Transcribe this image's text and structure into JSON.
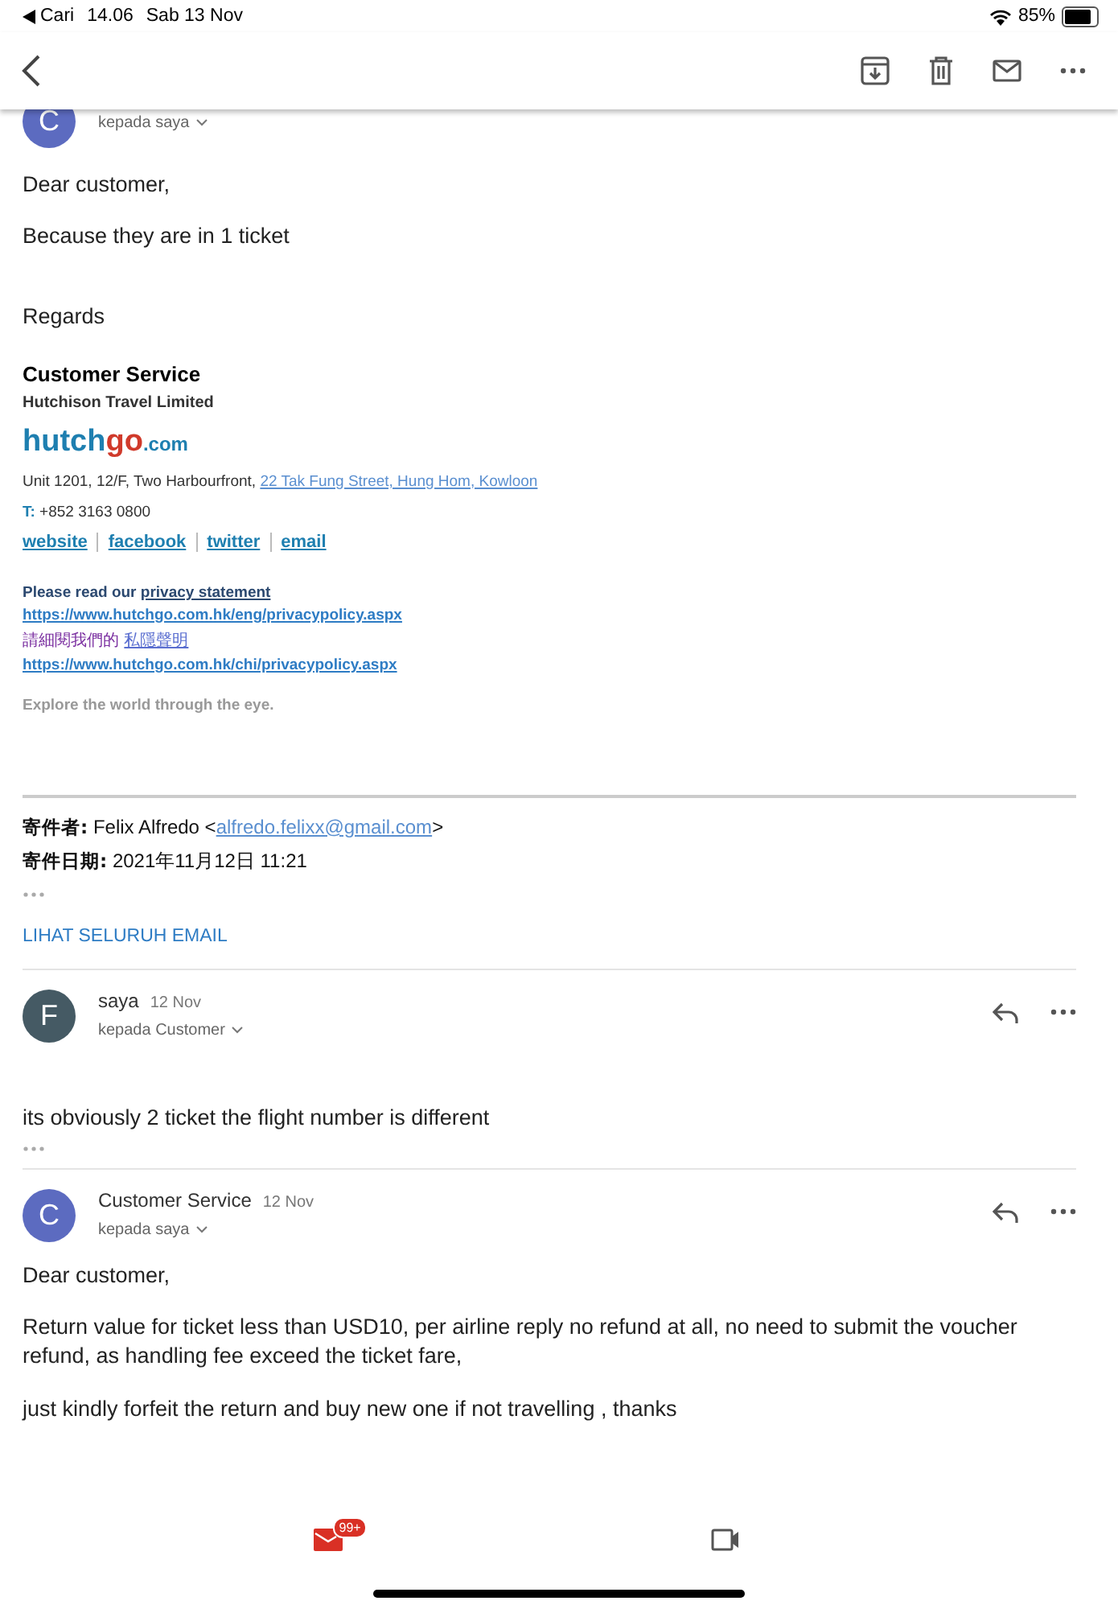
{
  "status_bar": {
    "back_app": "Cari",
    "time": "14.06",
    "date": "Sab 13 Nov",
    "battery": "85%"
  },
  "first_message": {
    "avatar": "C",
    "color": "#5c6bc0",
    "recipient": "kepada saya",
    "paragraphs": [
      "Dear customer,",
      "Because they are in 1 ticket",
      "Regards"
    ],
    "signature": {
      "name": "Customer Service",
      "company": "Hutchison Travel Limited",
      "logo_main": "hutch",
      "logo_accent": "go",
      "logo_suffix": ".com",
      "address": "Unit 1201, 12/F, Two Harbourfront, ",
      "address_link": "22 Tak Fung Street, Hung Hom, Kowloon",
      "phone_label": "T:",
      "phone": "+852 3163 0800",
      "links": [
        "website",
        "facebook",
        "twitter",
        "email"
      ],
      "privacy_text": "Please read our ",
      "privacy_link": "privacy statement",
      "privacy_url_en": "https://www.hutchgo.com.hk/eng/privacypolicy.aspx",
      "privacy_text_zh": "請細閱我們的 ",
      "privacy_link_zh": "私隱聲明",
      "privacy_url_zh": "https://www.hutchgo.com.hk/chi/privacypolicy.aspx",
      "tagline": "Explore the world through the eye."
    },
    "quoted": {
      "from_label": "寄件者:",
      "from_name": "Felix Alfredo <",
      "from_email": "alfredo.felixx@gmail.com",
      "from_end": ">",
      "date_label": "寄件日期:",
      "date": "2021年11月12日 11:21"
    },
    "show_all": "LIHAT SELURUH EMAIL"
  },
  "messages": [
    {
      "avatar": "F",
      "color": "#455a64",
      "sender": "saya",
      "date": "12 Nov",
      "recipient": "kepada Customer",
      "paragraphs": [
        "its obviously 2 ticket the flight number is different"
      ],
      "trimmed": true
    },
    {
      "avatar": "C",
      "color": "#5c6bc0",
      "sender": "Customer Service",
      "date": "12 Nov",
      "recipient": "kepada saya",
      "paragraphs": [
        "Dear customer,",
        "Return value for ticket less than USD10, per airline reply no refund at all, no need to submit the voucher refund, as handling fee exceed the ticket fare,",
        "just kindly forfeit the return and buy new one if not travelling , thanks"
      ],
      "trimmed": false
    }
  ],
  "bottom_bar": {
    "mail_badge": "99+"
  }
}
